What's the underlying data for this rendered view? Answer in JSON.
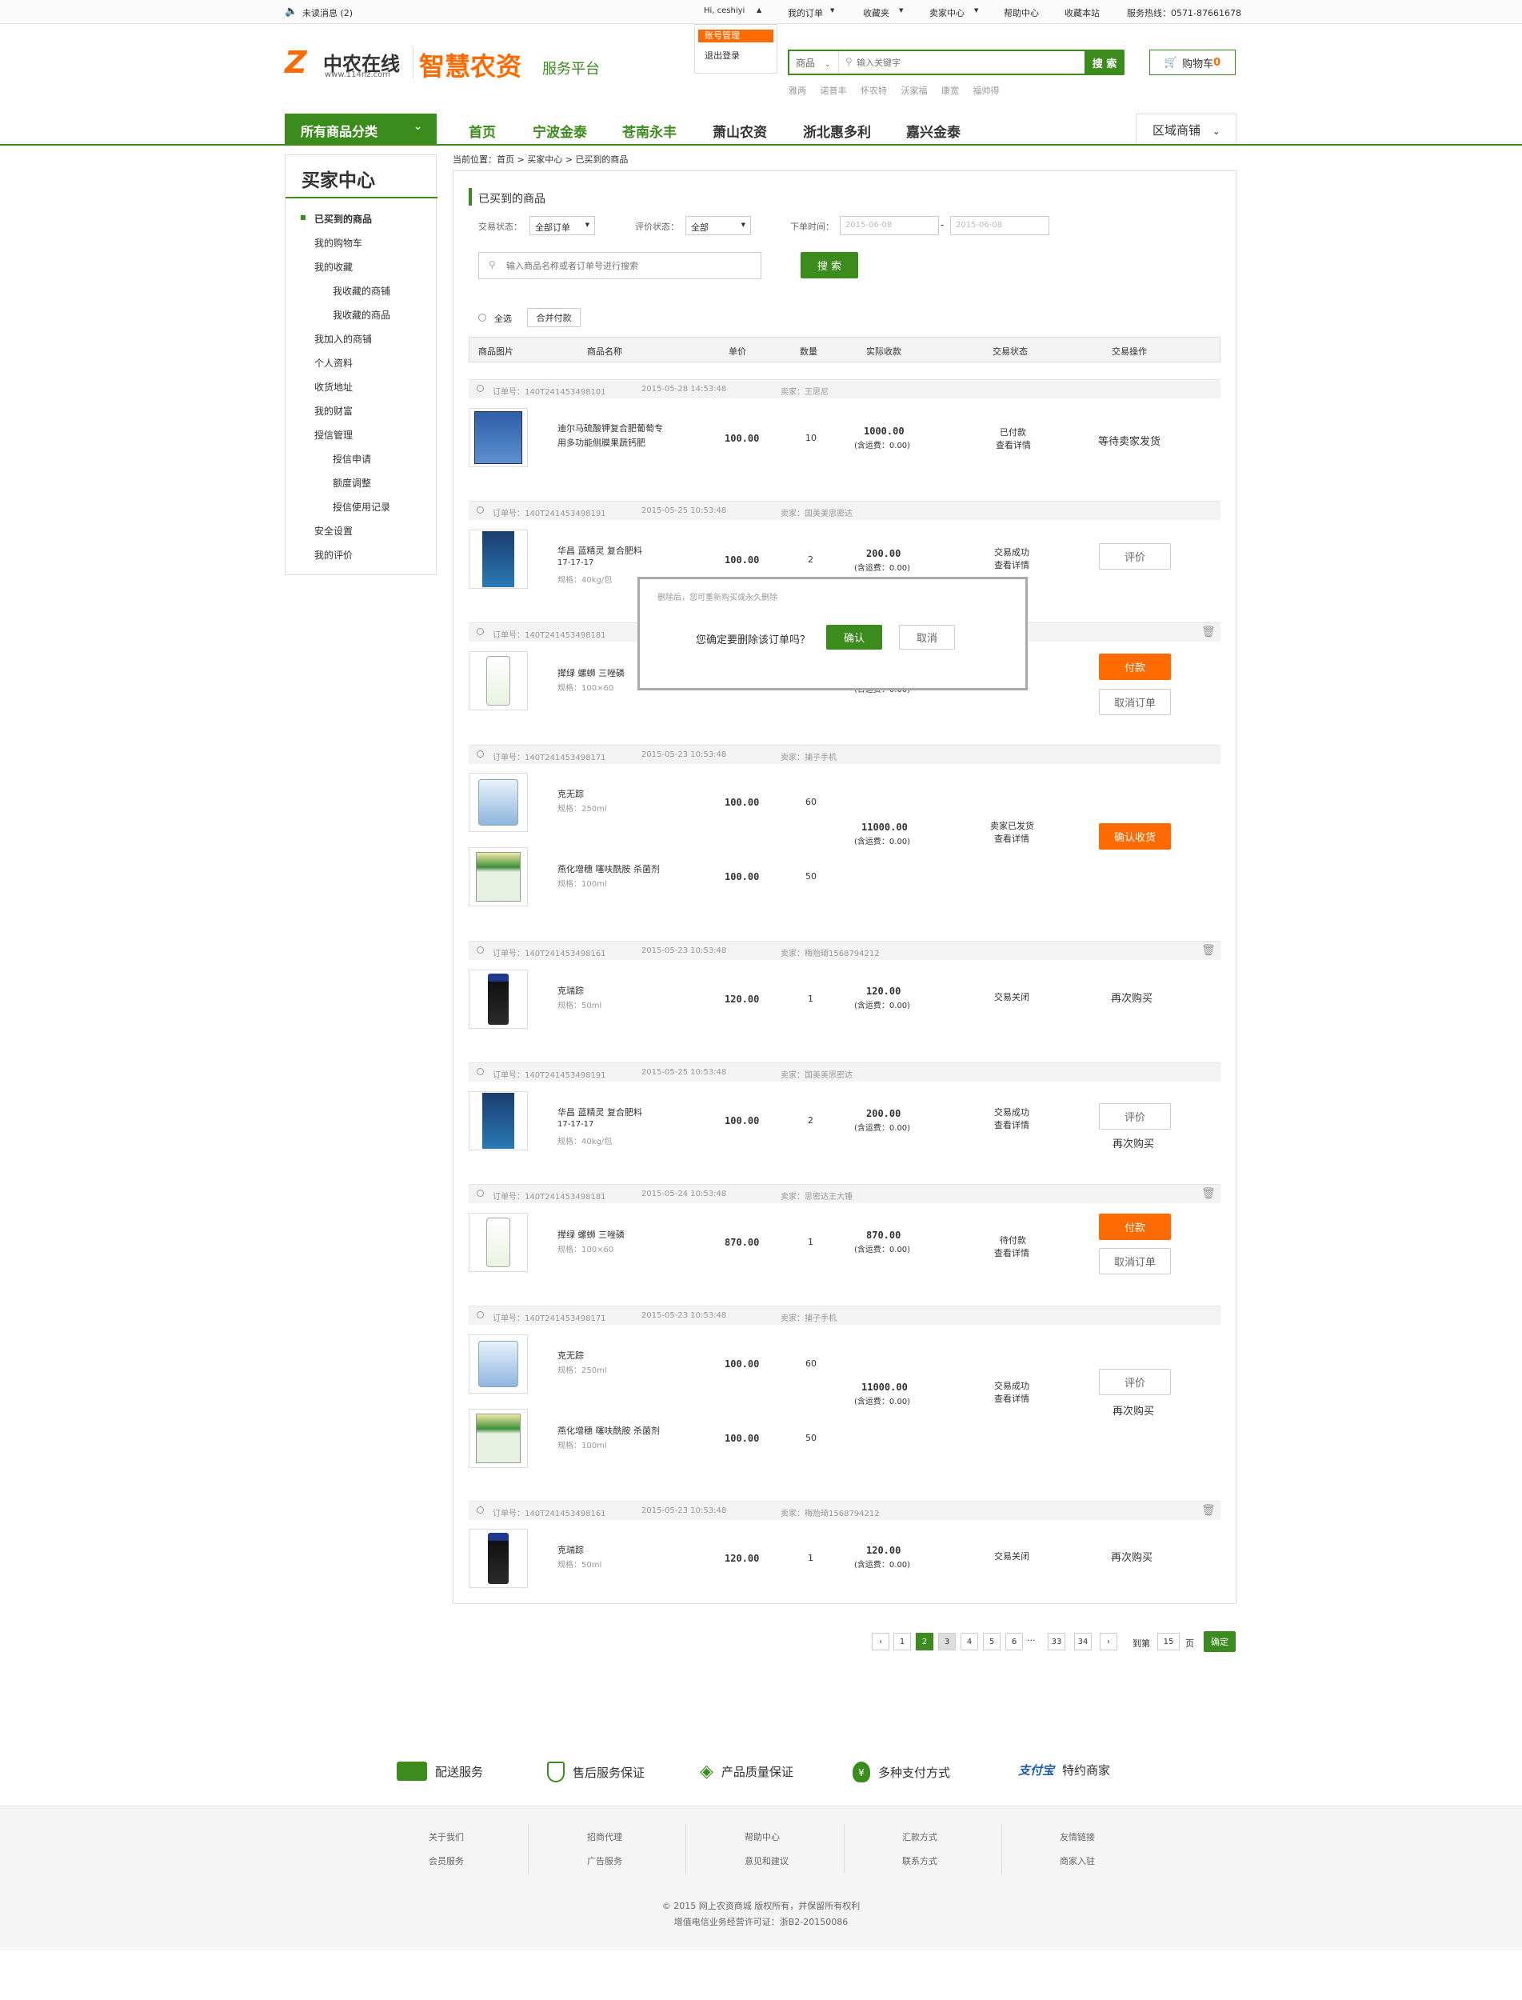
{
  "topbar": {
    "unread": "未读消息 (2)",
    "greeting": "Hi, ceshiyi",
    "my_orders": "我的订单",
    "favorites": "收藏夹",
    "seller_center": "卖家中心",
    "help": "帮助中心",
    "bookmark": "收藏本站",
    "hotline": "服务热线：0571-87661678",
    "dropdown": [
      "账号管理",
      "退出登录"
    ]
  },
  "header": {
    "logo_cn": "中农在线",
    "logo_url": "www.114nz.com",
    "slogan_main": "智慧农资",
    "slogan_sub": "服务平台",
    "search_scope": "商品",
    "search_placeholder": "输入关键字",
    "search_btn": "搜 索",
    "cart": "购物车",
    "cart_count": "0",
    "hot_words": [
      "雅两",
      "诺普丰",
      "怀农特",
      "沃家福",
      "康宽",
      "福帅得"
    ]
  },
  "nav": {
    "all_categories": "所有商品分类",
    "items": [
      "首页",
      "宁波金泰",
      "苍南永丰",
      "萧山农资",
      "浙北惠多利",
      "嘉兴金泰"
    ],
    "region": "区域商铺"
  },
  "sidebar": {
    "title": "买家中心",
    "items": [
      "已买到的商品",
      "我的购物车",
      "我的收藏",
      "我收藏的商铺",
      "我收藏的商品",
      "我加入的商铺",
      "个人资料",
      "收货地址",
      "我的财富",
      "授信管理",
      "授信申请",
      "额度调整",
      "授信使用记录",
      "安全设置",
      "我的评价"
    ]
  },
  "breadcrumb": "当前位置：首页 > 买家中心 > 已买到的商品",
  "main": {
    "title": "已买到的商品",
    "status_label": "交易状态：",
    "status_value": "全部订单",
    "rate_label": "评价状态：",
    "rate_value": "全部",
    "time_label": "下单时间：",
    "date_from": "2015-06-08",
    "date_to": "2015-06-08",
    "date_sep": "-",
    "search_placeholder": "输入商品名称或者订单号进行搜索",
    "search_btn": "搜 索",
    "select_all": "全选",
    "merge_pay": "合并付款",
    "columns": [
      "商品图片",
      "商品名称",
      "单价",
      "数量",
      "实际收款",
      "交易状态",
      "交易操作"
    ]
  },
  "orders": [
    {
      "no": "订单号：140T241453498101",
      "time": "2015-05-28 14:53:48",
      "seller": "卖家：王思尼",
      "items": [
        {
          "name": [
            "迪尔马硫酸钾复合肥葡萄专",
            "用多功能侧膜果蔬钙肥"
          ],
          "spec": "",
          "price": "100.00",
          "qty": "10"
        }
      ],
      "total": "1000.00",
      "freight": "(含运费：0.00)",
      "status": "已付款",
      "detail": "查看详情",
      "actions": [
        "等待卖家发货"
      ]
    },
    {
      "no": "订单号：140T241453498191",
      "time": "2015-05-25 10:53:48",
      "seller": "卖家：国美美思密达",
      "items": [
        {
          "name": [
            "华昌 蓝精灵 复合肥料",
            "17-17-17"
          ],
          "spec": "规格：40kg/包",
          "price": "100.00",
          "qty": "2"
        }
      ],
      "total": "200.00",
      "freight": "(含运费：0.00)",
      "status": "交易成功",
      "detail": "查看详情",
      "actions": [
        "评价"
      ]
    },
    {
      "no": "订单号：140T241453498181",
      "time": "",
      "seller": "",
      "items": [
        {
          "name": [
            "撵绿 螺蛳 三唑磷"
          ],
          "spec": "规格：100×60",
          "price": "",
          "qty": ""
        }
      ],
      "total": "",
      "freight": "(含运费：0.00)",
      "status": "",
      "detail": "",
      "actions": [
        "付款",
        "取消订单"
      ]
    },
    {
      "no": "订单号：140T241453498171",
      "time": "2015-05-23 10:53:48",
      "seller": "卖家：捕子手机",
      "items": [
        {
          "name": [
            "克无踪"
          ],
          "spec": "规格：250ml",
          "price": "100.00",
          "qty": "60"
        },
        {
          "name": [
            "燕化增穗 噻呋酰胺 杀菌剂"
          ],
          "spec": "规格：100ml",
          "price": "100.00",
          "qty": "50"
        }
      ],
      "total": "11000.00",
      "freight": "(含运费：0.00)",
      "status": "卖家已发货",
      "detail": "查看详情",
      "actions": [
        "确认收货"
      ]
    },
    {
      "no": "订单号：140T241453498161",
      "time": "2015-05-23 10:53:48",
      "seller": "卖家：梅贻琦1568794212",
      "items": [
        {
          "name": [
            "克瑞踪"
          ],
          "spec": "规格：50ml",
          "price": "120.00",
          "qty": "1"
        }
      ],
      "total": "120.00",
      "freight": "(含运费：0.00)",
      "status": "交易关闭",
      "detail": "",
      "actions": [
        "再次购买"
      ]
    },
    {
      "no": "订单号：140T241453498191",
      "time": "2015-05-25 10:53:48",
      "seller": "卖家：国美美思密达",
      "items": [
        {
          "name": [
            "华昌 蓝精灵 复合肥料",
            "17-17-17"
          ],
          "spec": "规格：40kg/包",
          "price": "100.00",
          "qty": "2"
        }
      ],
      "total": "200.00",
      "freight": "(含运费：0.00)",
      "status": "交易成功",
      "detail": "查看详情",
      "actions": [
        "评价",
        "再次购买"
      ]
    },
    {
      "no": "订单号：140T241453498181",
      "time": "2015-05-24 10:53:48",
      "seller": "卖家：思密达王大锤",
      "items": [
        {
          "name": [
            "撵绿 螺蛳 三唑磷"
          ],
          "spec": "规格：100×60",
          "price": "870.00",
          "qty": "1"
        }
      ],
      "total": "870.00",
      "freight": "(含运费：0.00)",
      "status": "待付款",
      "detail": "查看详情",
      "actions": [
        "付款",
        "取消订单"
      ]
    },
    {
      "no": "订单号：140T241453498171",
      "time": "2015-05-23 10:53:48",
      "seller": "卖家：捕子手机",
      "items": [
        {
          "name": [
            "克无踪"
          ],
          "spec": "规格：250ml",
          "price": "100.00",
          "qty": "60"
        },
        {
          "name": [
            "燕化增穗 噻呋酰胺 杀菌剂"
          ],
          "spec": "规格：100ml",
          "price": "100.00",
          "qty": "50"
        }
      ],
      "total": "11000.00",
      "freight": "(含运费：0.00)",
      "status": "交易成功",
      "detail": "查看详情",
      "actions": [
        "评价",
        "再次购买"
      ]
    },
    {
      "no": "订单号：140T241453498161",
      "time": "2015-05-23 10:53:48",
      "seller": "卖家：梅贻琦1568794212",
      "items": [
        {
          "name": [
            "克瑞踪"
          ],
          "spec": "规格：50ml",
          "price": "120.00",
          "qty": "1"
        }
      ],
      "total": "120.00",
      "freight": "(含运费：0.00)",
      "status": "交易关闭",
      "detail": "",
      "actions": [
        "再次购买"
      ]
    }
  ],
  "dialog": {
    "hint": "删除后，您可重新购买或永久删除",
    "question": "您确定要删除该订单吗？",
    "confirm": "确认",
    "cancel": "取消"
  },
  "pager": {
    "pages": [
      "1",
      "2",
      "3",
      "4",
      "5",
      "6",
      "···",
      "33",
      "34"
    ],
    "current": "2",
    "goto": "到第",
    "page_no": "15",
    "page_unit": "页",
    "confirm": "确定"
  },
  "services": [
    "配送服务",
    "售后服务保证",
    "产品质量保证",
    "多种支付方式",
    "特约商家"
  ],
  "alipay": "支付宝",
  "footer": {
    "cols": [
      [
        "关于我们",
        "会员服务"
      ],
      [
        "招商代理",
        "广告服务"
      ],
      [
        "帮助中心",
        "意见和建议"
      ],
      [
        "汇款方式",
        "联系方式"
      ],
      [
        "友情链接",
        "商家入驻"
      ]
    ],
    "copyright": "© 2015 网上农资商城 版权所有，并保留所有权利",
    "license": "增值电信业务经营许可证：浙B2-20150086"
  },
  "colors": {
    "brand_green": "#3b8b1d",
    "accent_orange": "#ff6a00"
  }
}
